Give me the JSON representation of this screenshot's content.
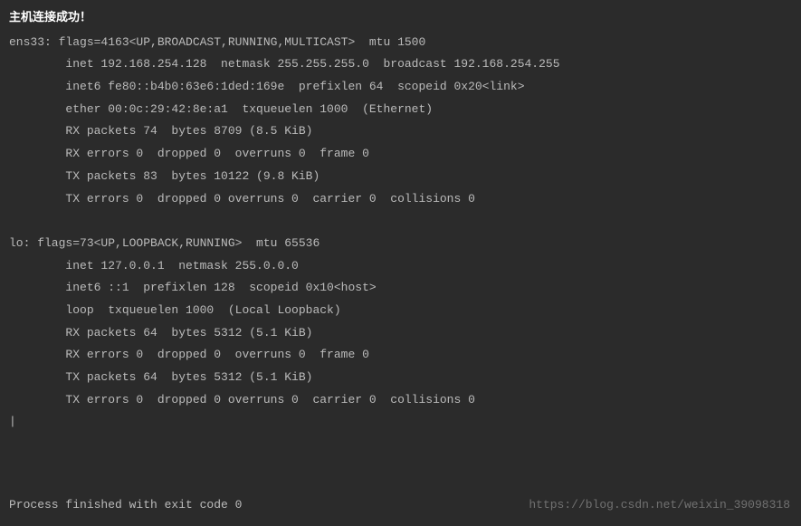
{
  "header": {
    "success_message": "主机连接成功！"
  },
  "ifconfig": {
    "ens33": {
      "line0": "ens33: flags=4163<UP,BROADCAST,RUNNING,MULTICAST>  mtu 1500",
      "line1": "        inet 192.168.254.128  netmask 255.255.255.0  broadcast 192.168.254.255",
      "line2": "        inet6 fe80::b4b0:63e6:1ded:169e  prefixlen 64  scopeid 0x20<link>",
      "line3": "        ether 00:0c:29:42:8e:a1  txqueuelen 1000  (Ethernet)",
      "line4": "        RX packets 74  bytes 8709 (8.5 KiB)",
      "line5": "        RX errors 0  dropped 0  overruns 0  frame 0",
      "line6": "        TX packets 83  bytes 10122 (9.8 KiB)",
      "line7": "        TX errors 0  dropped 0 overruns 0  carrier 0  collisions 0"
    },
    "lo": {
      "line0": "lo: flags=73<UP,LOOPBACK,RUNNING>  mtu 65536",
      "line1": "        inet 127.0.0.1  netmask 255.0.0.0",
      "line2": "        inet6 ::1  prefixlen 128  scopeid 0x10<host>",
      "line3": "        loop  txqueuelen 1000  (Local Loopback)",
      "line4": "        RX packets 64  bytes 5312 (5.1 KiB)",
      "line5": "        RX errors 0  dropped 0  overruns 0  frame 0",
      "line6": "        TX packets 64  bytes 5312 (5.1 KiB)",
      "line7": "        TX errors 0  dropped 0 overruns 0  carrier 0  collisions 0"
    }
  },
  "cursor": "|",
  "footer": {
    "exit_message": "Process finished with exit code 0"
  },
  "watermark": "https://blog.csdn.net/weixin_39098318"
}
